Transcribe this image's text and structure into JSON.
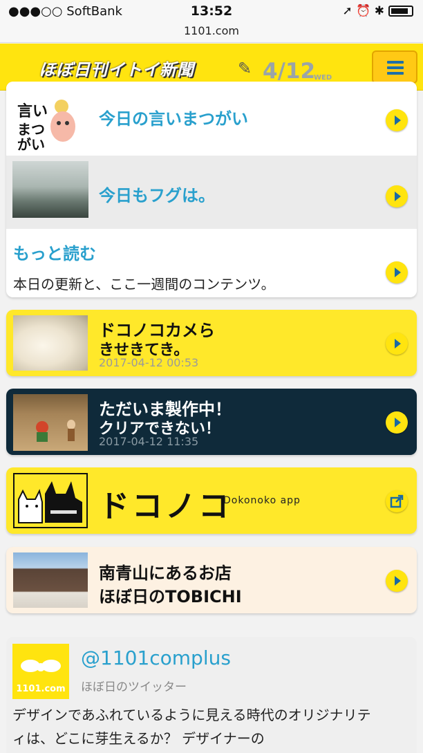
{
  "status_bar": {
    "carrier": "●●●○○ SoftBank",
    "time": "13:52",
    "url": "1101.com"
  },
  "header": {
    "logo": "ほぼ日刊イトイ新聞",
    "date": "4/12",
    "weekday": "WED"
  },
  "menu": {
    "items": [
      {
        "title": "今日の言いまつがい",
        "thumb_text": "言い まつがい"
      },
      {
        "title": "今日もフグは。"
      },
      {
        "title": "もっと読む",
        "desc": "本日の更新と、ここ一週間のコンテンツ。"
      }
    ]
  },
  "cards": [
    {
      "title1": "ドコノコカメら",
      "title2": "きせきてき。",
      "stamp": "2017-04-12 00:53"
    },
    {
      "title1": "ただいま製作中！",
      "title2": "クリアできない！",
      "stamp": "2017-04-12 11:35"
    },
    {
      "logo": "ドコノコ",
      "caption": "Dokonoko app"
    },
    {
      "title1": "南青山にあるお店",
      "title2": "ほぼ日のTOBICHI"
    }
  ],
  "twitter": {
    "handle": "@1101complus",
    "subtitle": "ほぼ日のツイッター",
    "avatar_text": "1101.com",
    "body": "デザインであふれているように見える時代のオリジナリティは、どこに芽生えるか？ デザイナーの"
  },
  "colors": {
    "brand_yellow": "#ffe40f",
    "link_blue": "#29a0cd",
    "dark_card": "#0f2a3a",
    "beige_card": "#fdf1e2"
  }
}
